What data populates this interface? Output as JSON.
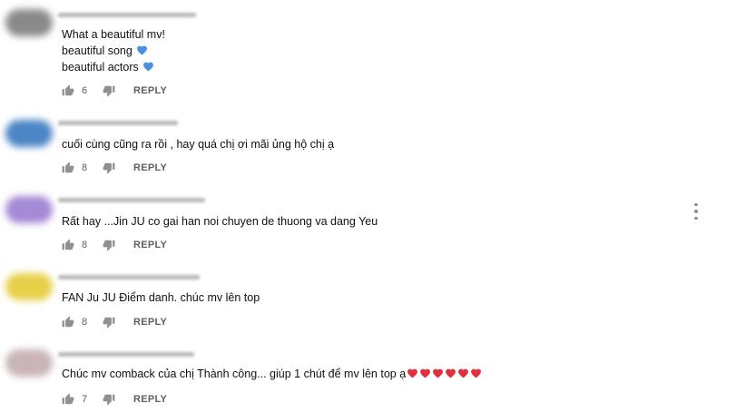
{
  "colors": {
    "action_icon": "#909090",
    "action_text": "#606060",
    "blue_heart": "#4a90e2",
    "red_heart": "#e0303f"
  },
  "reply_label": "REPLY",
  "comments": [
    {
      "lines": [
        "What a beautiful mv!",
        "beautiful song",
        "beautiful actors"
      ],
      "line_emoji": [
        "",
        "blue-heart",
        "blue-heart"
      ],
      "likes": "6",
      "avatar_color": "#8a8a8a"
    },
    {
      "lines": [
        "cuối cùng cũng ra rồi , hay quá chị ơi mãi ủng hộ chị ạ"
      ],
      "likes": "8",
      "avatar_color": "#4d86c6"
    },
    {
      "lines": [
        "Rất hay ...Jin JU co gai han noi chuyen de thuong va dang Yeu"
      ],
      "likes": "8",
      "avatar_color": "#a58ad6"
    },
    {
      "lines": [
        "FAN Ju JU Điểm danh. chúc mv lên top"
      ],
      "likes": "8",
      "avatar_color": "#e7d04a"
    },
    {
      "lines": [
        "Chúc mv comback của chị Thành công... giúp 1 chút để mv lên top ạ"
      ],
      "trailing_hearts": 6,
      "likes": "7",
      "avatar_color": "#c9b5b5"
    }
  ],
  "icons": {
    "like": "thumbs-up-icon",
    "dislike": "thumbs-down-icon",
    "menu": "more-vert-icon"
  }
}
